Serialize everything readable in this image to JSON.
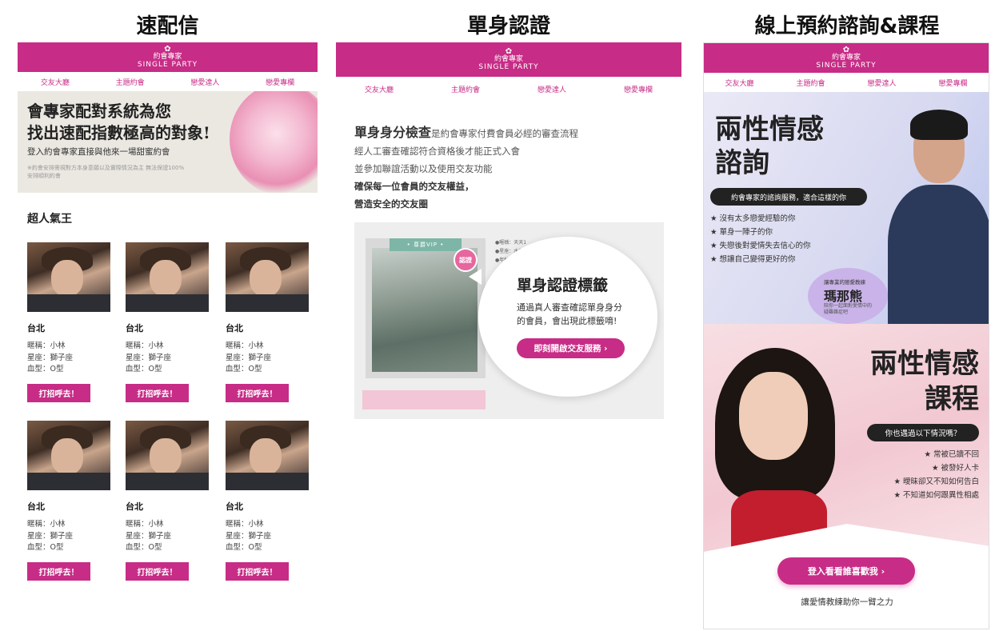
{
  "titles": [
    "速配信",
    "單身認證",
    "線上預約諮詢&課程"
  ],
  "brand": {
    "cn": "約會專家",
    "en": "SINGLE PARTY",
    "color": "#c72c86"
  },
  "nav": [
    "交友大廳",
    "主題約會",
    "戀愛達人",
    "戀愛專欄"
  ],
  "panel1": {
    "hero_line1": "會專家配對系統為您",
    "hero_line2": "找出速配指數極高的對象!",
    "hero_sub": "登入約會專家直接與他來一場甜蜜約會",
    "hero_note": "※約會安排需視對方本身意願以及實際情況為主 無法保證100%安排順利約會",
    "section_title": "超人氣王",
    "cards": [
      {
        "city": "台北",
        "nick": "暱稱：小林",
        "sign": "星座：獅子座",
        "blood": "血型：O型",
        "btn": "打招呼去！"
      },
      {
        "city": "台北",
        "nick": "暱稱：小林",
        "sign": "星座：獅子座",
        "blood": "血型：O型",
        "btn": "打招呼去！"
      },
      {
        "city": "台北",
        "nick": "暱稱：小林",
        "sign": "星座：獅子座",
        "blood": "血型：O型",
        "btn": "打招呼去！"
      },
      {
        "city": "台北",
        "nick": "暱稱：小林",
        "sign": "星座：獅子座",
        "blood": "血型：O型",
        "btn": "打招呼去！"
      },
      {
        "city": "台北",
        "nick": "暱稱：小林",
        "sign": "星座：獅子座",
        "blood": "血型：O型",
        "btn": "打招呼去！"
      },
      {
        "city": "台北",
        "nick": "暱稱：小林",
        "sign": "星座：獅子座",
        "blood": "血型：O型",
        "btn": "打招呼去！"
      }
    ]
  },
  "panel2": {
    "intro_big": "單身身分檢查",
    "intro_rest": "是約會專家付費會員必經的審查流程",
    "line2": "經人工審查確認符合資格後才能正式入會",
    "line3": "並參加聯誼活動以及使用交友功能",
    "line4": "確保每一位會員的交友權益，",
    "line5": "營造安全的交友圈",
    "vip_label": "• 尊爵VIP •",
    "seal": "認證",
    "meta": [
      "●暱稱：天天1",
      "●星座：水瓶座",
      "●年齡：30"
    ],
    "bubble_title": "單身認證標籤",
    "bubble_desc1": "通過真人審查確認單身身分",
    "bubble_desc2": "的會員，會出現此標籤唷!",
    "bubble_btn": "即刻開啟交友服務 ›"
  },
  "panel3": {
    "top_title1": "兩性情感",
    "top_title2": "諮詢",
    "top_pill": "約會專家的諮詢服務，適合這樣的你",
    "top_list": [
      "★ 沒有太多戀愛經驗的你",
      "★ 單身一陣子的你",
      "★ 失戀後對愛情失去信心的你",
      "★ 想讓自己變得更好的你"
    ],
    "coach_label": "讓專業的戀愛教練",
    "coach_name": "瑪那熊",
    "coach_note": "陪你一起面對愛情中的疑難雜症吧",
    "bot_title1": "兩性情感",
    "bot_title2": "課程",
    "bot_pill": "你也遇過以下情況嗎？",
    "bot_list": [
      "★ 常被已讀不回",
      "★ 被發好人卡",
      "★ 曖昧卻又不知如何告白",
      "★ 不知道如何跟異性相處"
    ],
    "cta": "登入看看誰喜歡我 ›",
    "footer": "讓愛情教練助你一臂之力"
  }
}
